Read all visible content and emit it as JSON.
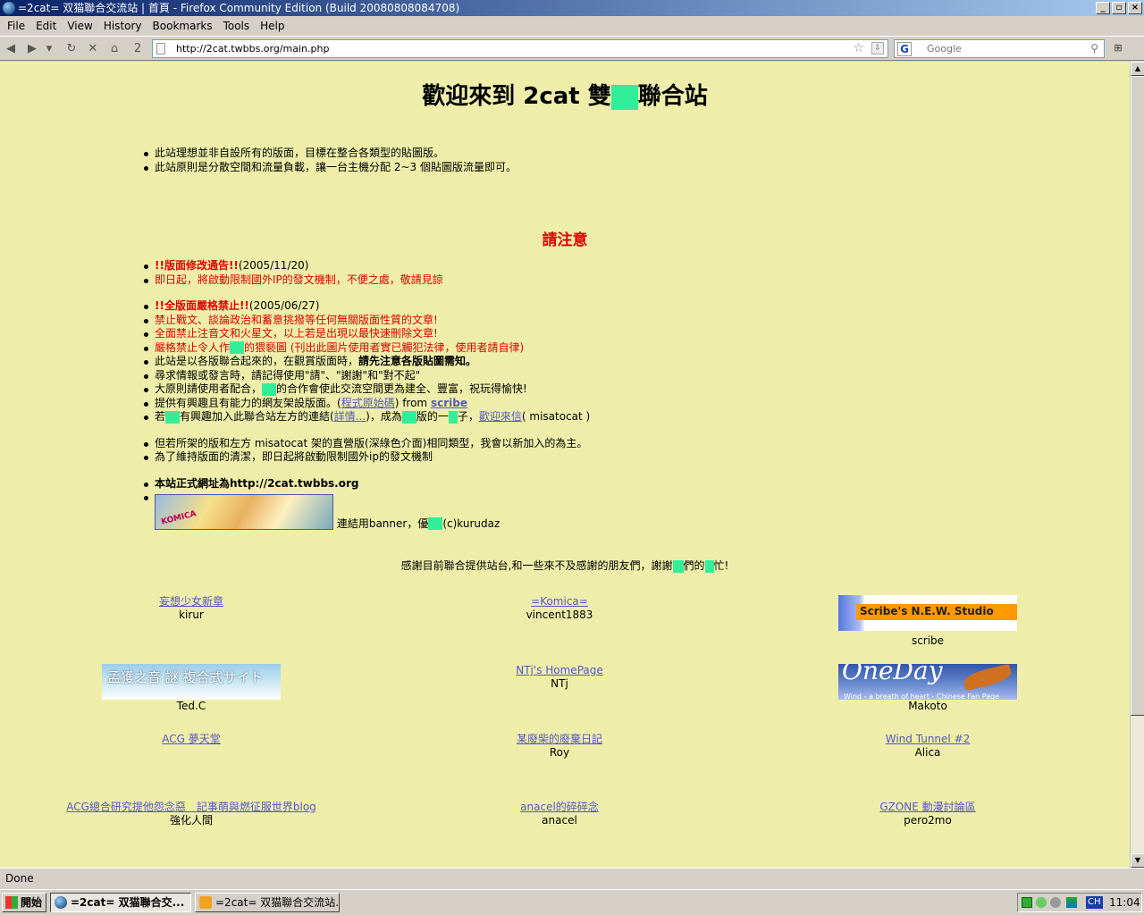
{
  "window": {
    "title": "=2cat= 双猫聯合交流站 | 首頁 - Firefox Community Edition (Build 20080808084708)",
    "buttons": [
      "_",
      "▫",
      "×"
    ]
  },
  "menu": [
    "File",
    "Edit",
    "View",
    "History",
    "Bookmarks",
    "Tools",
    "Help"
  ],
  "nav": {
    "back_icon": "◀",
    "forward_icon": "▶",
    "dropdown_icon": "▾",
    "reload_icon": "↻",
    "stop_icon": "✕",
    "home_icon": "⌂",
    "tab_count": "2",
    "url": "http://2cat.twbbs.org/main.php",
    "star_icon": "☆",
    "go_icon": "⇩",
    "search_engine_icon": "G",
    "search_placeholder": "Google",
    "search_icon": "⚲",
    "extra_icon": "⊞"
  },
  "page": {
    "title_pre": "歡迎來到 2cat 雙",
    "title_post": "聯合站",
    "intro": [
      "此站理想並非自設所有的版面，目標在整合各類型的貼圖版。",
      "此站原則是分散空間和流量負載，讓一台主機分配 2~3 個貼圖版流量即可。"
    ],
    "notice_title": "請注意",
    "notice1": {
      "heading": "!!版面修改通告!!",
      "date": "(2005/11/20)",
      "text": "即日起，將啟動限制國外IP的發文機制，不便之處，敬請見諒"
    },
    "notice2": {
      "heading": "!!全版面嚴格禁止!!",
      "date": "(2005/06/27)",
      "lines": [
        "禁止戰文、談論政治和蓄意挑撥等任何無關版面性質的文章!",
        "全面禁止注音文和火星文，以上若是出現以最快速刪除文章!"
      ],
      "forbid_pre": "嚴格禁止令人作",
      "forbid_post": "的猥褻圖 (刊出此圖片使用者實已觸犯法律，使用者請自律)"
    },
    "rules": {
      "line1_pre": "此站是以各版聯合起來的，在觀賞版面時，",
      "line1_bold": "請先注意各版貼圖需知。",
      "line2": "尋求情報或發言時，請記得使用\"請\"、\"謝謝\"和\"對不起\"",
      "line3_pre": "大原則請使用者配合，",
      "line3_post": "的合作會使此交流空間更為建全、豐富，祝玩得愉快!",
      "line4_pre": "提供有興趣且有能力的網友架設版面。(",
      "line4_link": "程式原始碼",
      "line4_mid": ") from ",
      "line4_scribe": "scribe",
      "line5_a": "若",
      "line5_b": "有興趣加入此聯合站左方的連結(",
      "line5_link1": "詳情...",
      "line5_c": ")，成為",
      "line5_d": "版的一",
      "line5_e": "子，",
      "line5_link2": "歡迎來信",
      "line5_f": "( misatocat )"
    },
    "extra": [
      "但若所架的版和左方 misatocat 架的直營版(深綠色介面)相同類型，我會以新加入的為主。",
      "為了維持版面的清潔，即日起將啟動限制國外ip的發文機制"
    ],
    "official_url": "本站正式網址為http://2cat.twbbs.org",
    "banner_alt": "KOMICA",
    "banner_caption_pre": "連結用banner，優",
    "banner_caption_post": "(c)kurudaz",
    "thanks_pre": "感謝目前聯合提供站台,和一些來不及感謝的朋友們，謝謝",
    "thanks_mid": "們的",
    "thanks_post": "忙!"
  },
  "sites": [
    {
      "name": "妄想少女新章",
      "owner": "kirur"
    },
    {
      "name": "=Komica=",
      "owner": "vincent1883"
    },
    {
      "name": "Scribe's N.E.W. Studio",
      "owner": "scribe"
    },
    {
      "name": "孟獲之音 謎 複合式サイト",
      "owner": "Ted.C"
    },
    {
      "name": "NTj's HomePage",
      "owner": "NTj"
    },
    {
      "name": "OneDay",
      "name_sub": "Wind - a breath of heart - Chinese Fan Page",
      "owner": "Makoto"
    },
    {
      "name": "ACG 夢天堂",
      "owner": ""
    },
    {
      "name": "某廢柴的廢棄日記",
      "owner": "Roy"
    },
    {
      "name": "Wind Tunnel #2",
      "owner": "Alica"
    },
    {
      "name": "ACG總合研究提他怨念惡　記事萌與燃征服世界blog",
      "owner": "強化人間"
    },
    {
      "name": "anacel的碎碎念",
      "owner": "anacel"
    },
    {
      "name": "GZONE 動漫討論區",
      "owner": "pero2mo"
    }
  ],
  "status": "Done",
  "taskbar": {
    "start": "開始",
    "tasks": [
      "=2cat= 双猫聯合交...",
      "=2cat= 双猫聯合交流站..."
    ],
    "lang": "CH",
    "clock": "11:04"
  },
  "colors": {
    "page_bg": "#eeeeaa",
    "notice_red": "#e00000",
    "link": "#5555cc",
    "censor": "#33ee99"
  }
}
